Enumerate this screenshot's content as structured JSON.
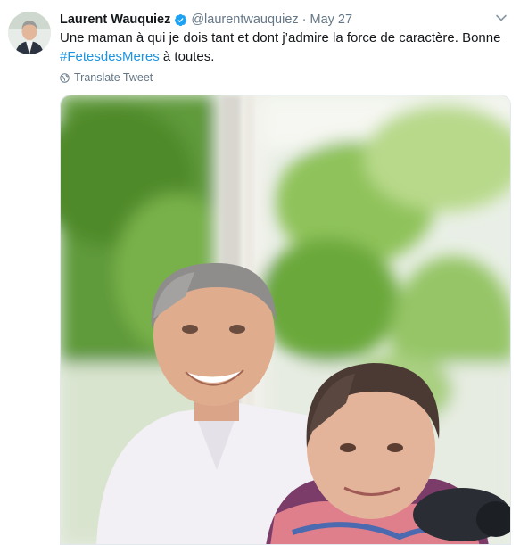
{
  "tweet": {
    "author_name": "Laurent Wauquiez",
    "handle": "@laurentwauquiez",
    "separator": "·",
    "date": "May 27",
    "text_before": "Une maman à qui je dois tant et dont j’admire la force de caractère. Bonne ",
    "hashtag": "#FetesdesMeres",
    "text_after": " à toutes.",
    "translate_label": "Translate Tweet"
  },
  "icons": {
    "verified": "verified-badge-icon",
    "caret": "chevron-down-icon",
    "globe": "globe-icon"
  },
  "colors": {
    "link": "#1b95e0",
    "secondary_text": "#657786",
    "verified": "#1da1f2"
  }
}
